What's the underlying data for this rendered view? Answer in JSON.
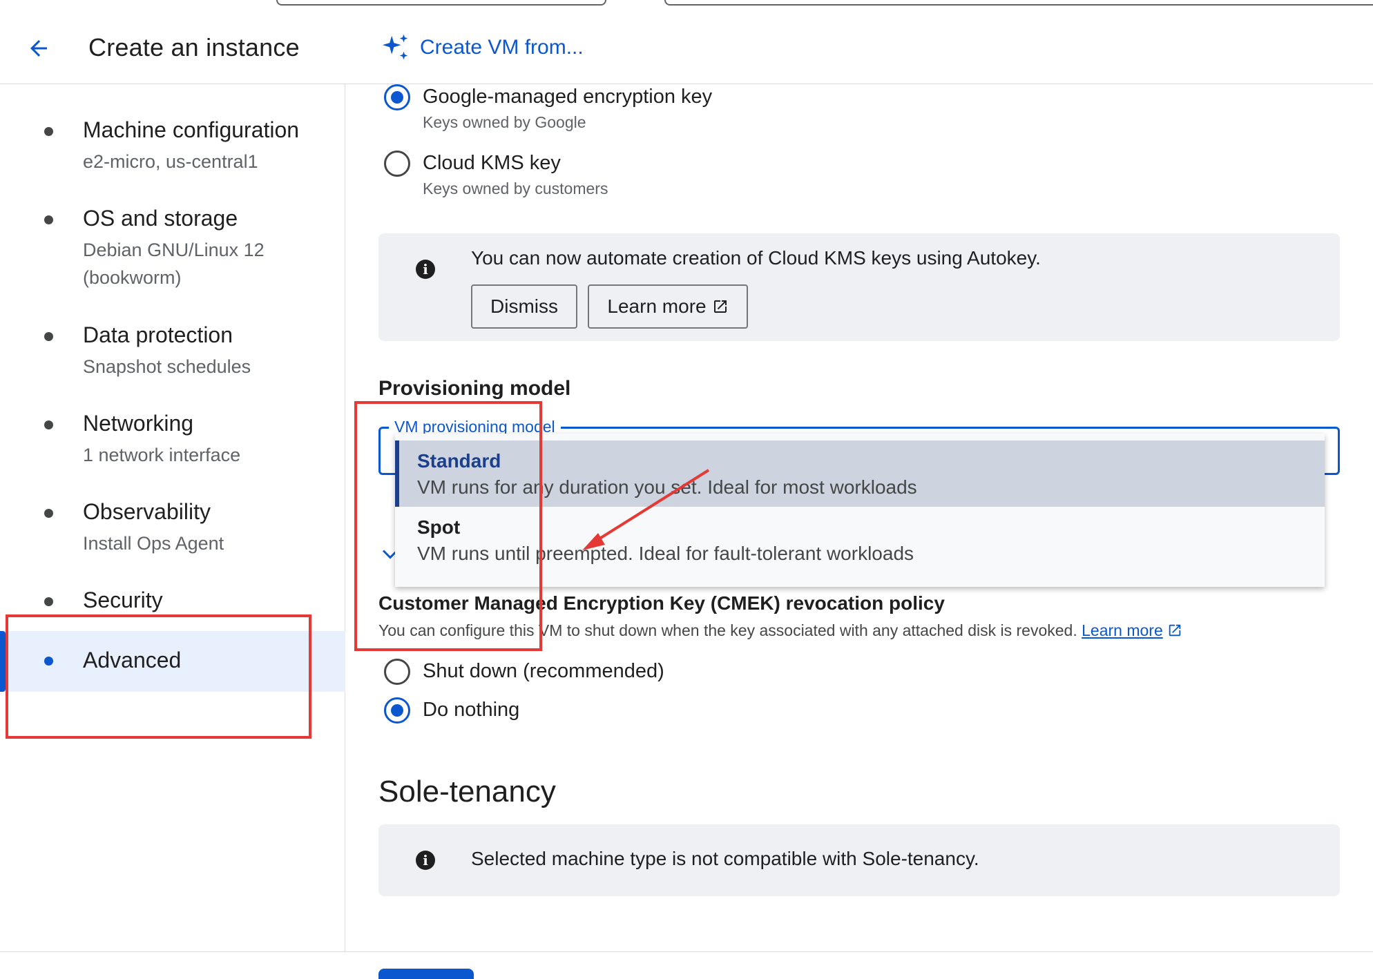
{
  "header": {
    "title": "Create an instance",
    "create_from_label": "Create VM from..."
  },
  "sidebar": {
    "items": [
      {
        "title": "Machine configuration",
        "sub": [
          "e2-micro, us-central1"
        ]
      },
      {
        "title": "OS and storage",
        "sub": [
          "Debian GNU/Linux 12",
          "(bookworm)"
        ]
      },
      {
        "title": "Data protection",
        "sub": [
          "Snapshot schedules"
        ]
      },
      {
        "title": "Networking",
        "sub": [
          "1 network interface"
        ]
      },
      {
        "title": "Observability",
        "sub": [
          "Install Ops Agent"
        ]
      },
      {
        "title": "Security",
        "sub": []
      },
      {
        "title": "Advanced",
        "sub": []
      }
    ]
  },
  "encryption": {
    "options": [
      {
        "label": "Google-managed encryption key",
        "sub": "Keys owned by Google",
        "checked": true
      },
      {
        "label": "Cloud KMS key",
        "sub": "Keys owned by customers",
        "checked": false
      }
    ],
    "autokey_notice": "You can now automate creation of Cloud KMS keys using Autokey.",
    "dismiss_label": "Dismiss",
    "learn_more_label": "Learn more"
  },
  "provisioning": {
    "title": "Provisioning model",
    "field_label": "VM provisioning model",
    "options": [
      {
        "title": "Standard",
        "desc": "VM runs for any duration you set. Ideal for most workloads",
        "selected": true
      },
      {
        "title": "Spot",
        "desc": "VM runs until preempted. Ideal for fault-tolerant workloads",
        "selected": false
      }
    ]
  },
  "cmek": {
    "title": "Customer Managed Encryption Key (CMEK) revocation policy",
    "help": "You can configure this VM to shut down when the key associated with any attached disk is revoked.",
    "learn_more_label": "Learn more",
    "options": [
      {
        "label": "Shut down (recommended)",
        "checked": false
      },
      {
        "label": "Do nothing",
        "checked": true
      }
    ]
  },
  "sole_tenancy": {
    "title": "Sole-tenancy",
    "notice": "Selected machine type is not compatible with Sole-tenancy."
  },
  "colors": {
    "accent": "#0b57d0",
    "annotation": "#e53935",
    "info_bg": "#eef0f4"
  },
  "icons": {
    "back": "arrow-left-icon",
    "create_from": "sparkle-icon",
    "info": "info-icon",
    "external": "open-in-new-icon"
  }
}
